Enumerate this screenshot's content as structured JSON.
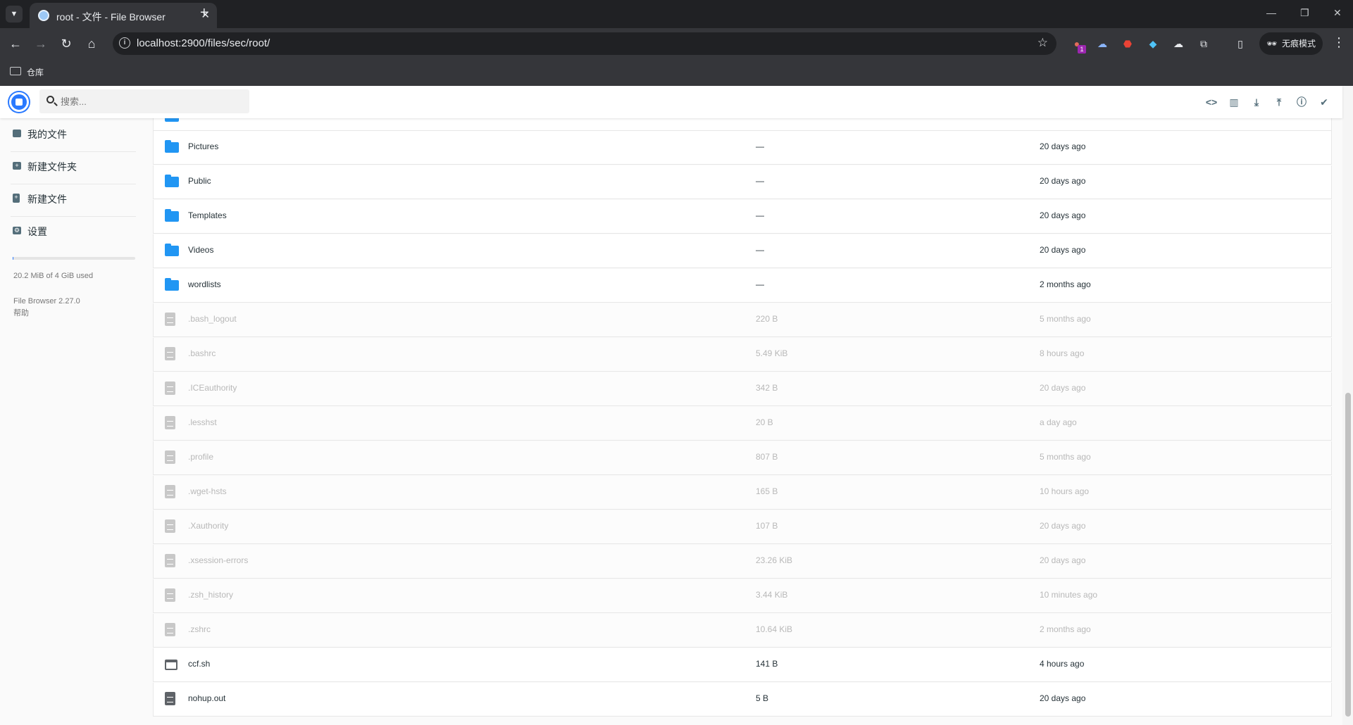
{
  "browser": {
    "tab_title": "root - 文件 - File Browser",
    "url": "localhost:2900/files/sec/root/",
    "bookmark_label": "仓库",
    "incognito_label": "无痕模式",
    "extension_badge": "1"
  },
  "header": {
    "search_placeholder": "搜索..."
  },
  "sidebar": {
    "items": [
      {
        "label": "我的文件"
      },
      {
        "label": "新建文件夹"
      },
      {
        "label": "新建文件"
      },
      {
        "label": "设置"
      }
    ],
    "quota_text": "20.2 MiB of 4 GiB used",
    "quota_fraction": 0.005,
    "version": "File Browser 2.27.0",
    "help": "帮助"
  },
  "files": [
    {
      "name": "Pictures",
      "size": "—",
      "modified": "20 days ago",
      "type": "folder"
    },
    {
      "name": "Public",
      "size": "—",
      "modified": "20 days ago",
      "type": "folder"
    },
    {
      "name": "Templates",
      "size": "—",
      "modified": "20 days ago",
      "type": "folder"
    },
    {
      "name": "Videos",
      "size": "—",
      "modified": "20 days ago",
      "type": "folder"
    },
    {
      "name": "wordlists",
      "size": "—",
      "modified": "2 months ago",
      "type": "folder"
    },
    {
      "name": ".bash_logout",
      "size": "220 B",
      "modified": "5 months ago",
      "type": "hidden-file"
    },
    {
      "name": ".bashrc",
      "size": "5.49 KiB",
      "modified": "8 hours ago",
      "type": "hidden-file"
    },
    {
      "name": ".ICEauthority",
      "size": "342 B",
      "modified": "20 days ago",
      "type": "hidden-file"
    },
    {
      "name": ".lesshst",
      "size": "20 B",
      "modified": "a day ago",
      "type": "hidden-file"
    },
    {
      "name": ".profile",
      "size": "807 B",
      "modified": "5 months ago",
      "type": "hidden-file"
    },
    {
      "name": ".wget-hsts",
      "size": "165 B",
      "modified": "10 hours ago",
      "type": "hidden-file"
    },
    {
      "name": ".Xauthority",
      "size": "107 B",
      "modified": "20 days ago",
      "type": "hidden-file"
    },
    {
      "name": ".xsession-errors",
      "size": "23.26 KiB",
      "modified": "20 days ago",
      "type": "hidden-file"
    },
    {
      "name": ".zsh_history",
      "size": "3.44 KiB",
      "modified": "10 minutes ago",
      "type": "hidden-file"
    },
    {
      "name": ".zshrc",
      "size": "10.64 KiB",
      "modified": "2 months ago",
      "type": "hidden-file"
    },
    {
      "name": "ccf.sh",
      "size": "141 B",
      "modified": "4 hours ago",
      "type": "script"
    },
    {
      "name": "nohup.out",
      "size": "5 B",
      "modified": "20 days ago",
      "type": "file"
    }
  ]
}
